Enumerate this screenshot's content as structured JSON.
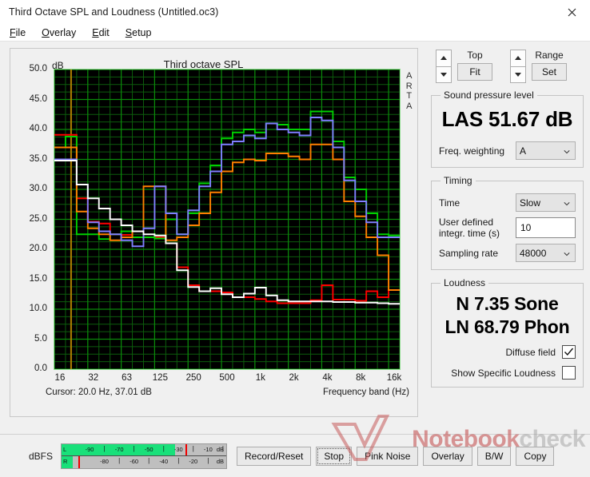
{
  "window": {
    "title": "Third Octave SPL and Loudness (Untitled.oc3)",
    "close_icon": "close-icon"
  },
  "menu": [
    {
      "label": "File",
      "accel": "F"
    },
    {
      "label": "Overlay",
      "accel": "O"
    },
    {
      "label": "Edit",
      "accel": "E"
    },
    {
      "label": "Setup",
      "accel": "S"
    }
  ],
  "chart_panel": {
    "y_axis_unit": "dB",
    "title": "Third octave SPL",
    "watermark": "ARTA",
    "cursor_text": "Cursor:    20.0 Hz, 37.01 dB",
    "x_axis_label": "Frequency band (Hz)"
  },
  "graph_controls": {
    "top_label": "Top",
    "top_button": "Fit",
    "range_label": "Range",
    "range_button": "Set",
    "spin_up_icon": "chevron-up-icon",
    "spin_down_icon": "chevron-down-icon"
  },
  "spl": {
    "group_label": "Sound pressure level",
    "value": "LAS 51.67 dB",
    "weighting_label": "Freq. weighting",
    "weighting_value": "A",
    "chevron_icon": "chevron-down-icon"
  },
  "timing": {
    "group_label": "Timing",
    "time_label": "Time",
    "time_value": "Slow",
    "integr_label_line1": "User defined",
    "integr_label_line2": "integr. time (s)",
    "integr_value": "10",
    "sampling_label": "Sampling rate",
    "sampling_value": "48000"
  },
  "loudness": {
    "group_label": "Loudness",
    "sone": "N 7.35 Sone",
    "phon": "LN 68.79 Phon",
    "diffuse_label": "Diffuse field",
    "diffuse_checked": true,
    "specific_label": "Show Specific Loudness",
    "specific_checked": false,
    "check_icon": "check-icon"
  },
  "bottom": {
    "dbfs_label": "dBFS",
    "meter": {
      "left_channel": "L",
      "right_channel": "R",
      "unit": "dB",
      "top_ticks": [
        "-90",
        "-70",
        "-50",
        "-30",
        "-10"
      ],
      "bottom_ticks": [
        "-80",
        "-60",
        "-40",
        "-20"
      ],
      "left_fill_percent": 69,
      "left_peak_percent": 75,
      "right_fill_percent": 7,
      "right_peak_percent": 10
    },
    "buttons": [
      {
        "label": "Record/Reset",
        "focused": false
      },
      {
        "label": "Stop",
        "focused": true
      },
      {
        "label": "Pink Noise",
        "focused": false
      },
      {
        "label": "Overlay",
        "focused": false
      },
      {
        "label": "B/W",
        "focused": false
      },
      {
        "label": "Copy",
        "focused": false
      }
    ]
  },
  "watermark": {
    "part1": "Notebook",
    "part2": "check"
  },
  "chart_data": {
    "type": "line",
    "title": "Third octave SPL",
    "xlabel": "Frequency band (Hz)",
    "ylabel": "dB",
    "ylim": [
      0,
      50
    ],
    "ytick_step": 5,
    "grid": true,
    "legend": "none",
    "step_style": "stepped",
    "background": "#000000",
    "grid_color": "#0a8a0a",
    "categories": [
      "16",
      "20",
      "25",
      "31.5",
      "40",
      "50",
      "63",
      "80",
      "100",
      "125",
      "160",
      "200",
      "250",
      "315",
      "400",
      "500",
      "630",
      "800",
      "1k",
      "1.25k",
      "1.6k",
      "2k",
      "2.5k",
      "3.15k",
      "4k",
      "5k",
      "6.3k",
      "8k",
      "10k",
      "12.5k",
      "16k"
    ],
    "xtick_labels": [
      "16",
      "32",
      "63",
      "125",
      "250",
      "500",
      "1k",
      "2k",
      "4k",
      "8k",
      "16k"
    ],
    "series": [
      {
        "name": "red",
        "color": "#ff0000",
        "values": [
          39.1,
          39.1,
          28.5,
          24.6,
          24.3,
          22.5,
          22.4,
          22.0,
          22.0,
          22.0,
          21.0,
          17.0,
          14.0,
          13.0,
          13.0,
          12.8,
          12.0,
          12.0,
          11.7,
          11.3,
          11.0,
          11.0,
          11.0,
          11.5,
          14.0,
          11.6,
          11.6,
          11.4,
          13.0,
          12.0,
          13.2
        ]
      },
      {
        "name": "green",
        "color": "#00d000",
        "values": [
          37.0,
          38.8,
          22.5,
          22.5,
          21.7,
          22.5,
          23.0,
          22.0,
          22.0,
          21.8,
          25.0,
          22.5,
          26.0,
          31.0,
          34.0,
          38.5,
          39.5,
          40.0,
          39.5,
          41.0,
          40.8,
          40.0,
          40.0,
          43.0,
          43.0,
          38.0,
          32.0,
          30.0,
          26.0,
          22.5,
          22.3
        ]
      },
      {
        "name": "orange",
        "color": "#ff8000",
        "values": [
          37.0,
          37.0,
          26.3,
          23.5,
          22.5,
          21.5,
          22.0,
          23.0,
          30.5,
          30.5,
          21.5,
          22.0,
          24.0,
          26.0,
          29.5,
          33.0,
          34.5,
          35.0,
          34.8,
          36.0,
          36.0,
          35.5,
          35.0,
          37.5,
          37.5,
          35.0,
          28.0,
          25.5,
          22.0,
          19.0,
          13.2
        ]
      },
      {
        "name": "blue",
        "color": "#7f7fff",
        "values": [
          35.0,
          35.0,
          30.8,
          24.5,
          23.0,
          22.5,
          21.5,
          20.5,
          23.5,
          30.5,
          26.0,
          22.5,
          26.5,
          30.5,
          33.0,
          37.5,
          38.0,
          39.0,
          38.5,
          41.0,
          40.0,
          39.5,
          39.0,
          42.0,
          41.5,
          37.0,
          31.5,
          28.0,
          24.5,
          22.0,
          22.0
        ]
      },
      {
        "name": "white",
        "color": "#ffffff",
        "values": [
          34.8,
          34.8,
          30.8,
          28.5,
          26.8,
          25.0,
          24.0,
          23.0,
          22.5,
          22.3,
          21.0,
          16.5,
          13.7,
          13.0,
          13.5,
          12.5,
          12.0,
          12.6,
          13.6,
          12.3,
          11.5,
          11.3,
          11.3,
          11.3,
          11.3,
          11.2,
          11.2,
          11.1,
          11.1,
          11.0,
          10.9
        ]
      }
    ],
    "cursor_line": {
      "frequency": 20.0,
      "level": 37.01,
      "color": "#b08000"
    }
  }
}
